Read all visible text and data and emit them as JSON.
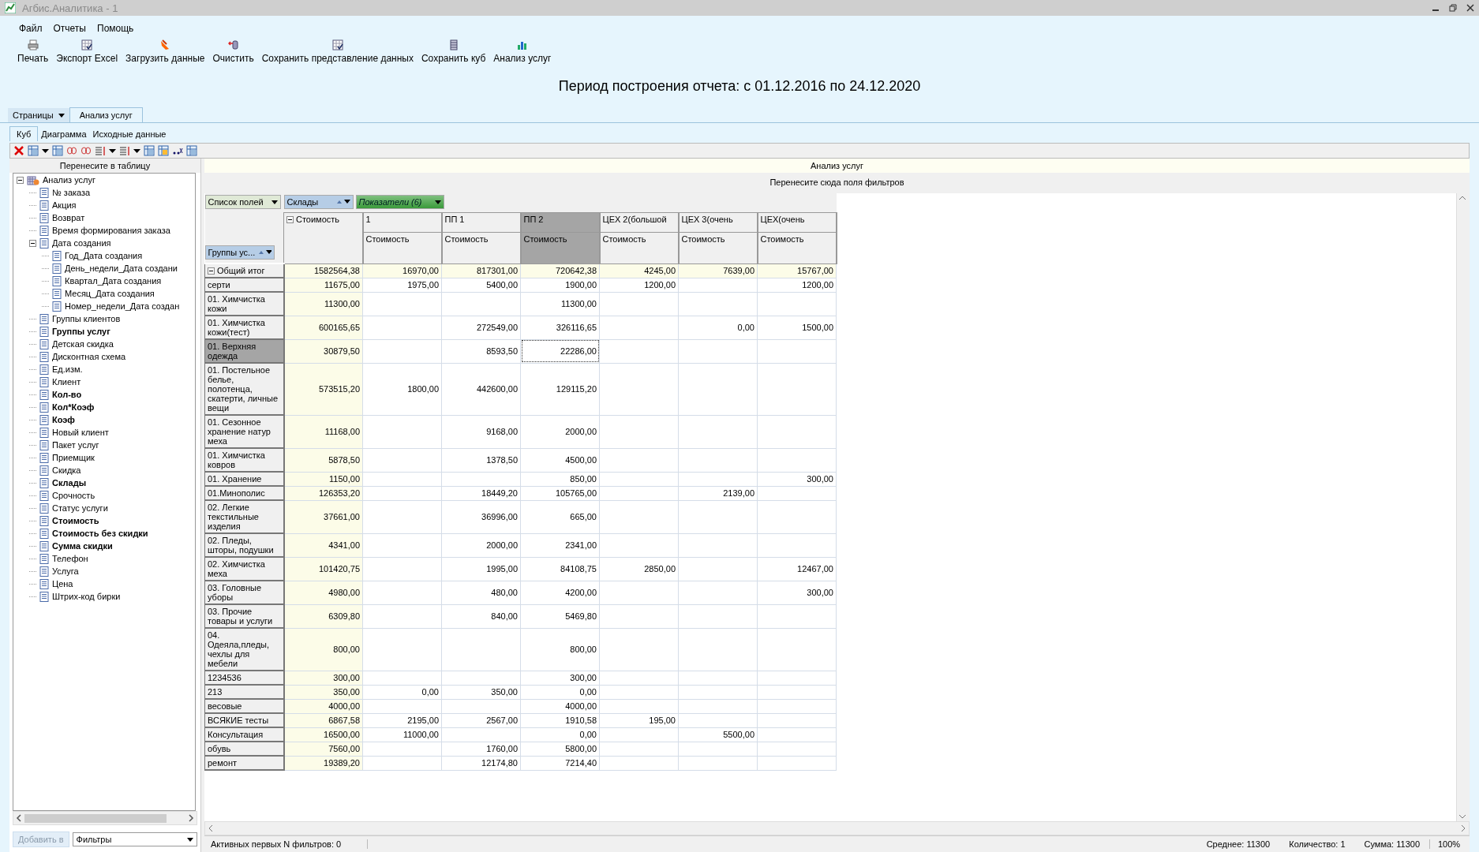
{
  "window": {
    "title": "Агбис.Аналитика - 1"
  },
  "menu": [
    "Файл",
    "Отчеты",
    "Помощь"
  ],
  "toolbar": [
    {
      "label": "Печать",
      "kind": "print"
    },
    {
      "label": "Экспорт Excel",
      "kind": "table"
    },
    {
      "label": "Загрузить данные",
      "kind": "load"
    },
    {
      "label": "Очистить",
      "kind": "clear"
    },
    {
      "label": "Сохранить представление данных",
      "kind": "table"
    },
    {
      "label": "Сохранить куб",
      "kind": "cube"
    },
    {
      "label": "Анализ услуг",
      "kind": "chart"
    }
  ],
  "report_period": "Период построения отчета: с 01.12.2016 по 24.12.2020",
  "pages_menu": "Страницы",
  "page_tabs": [
    {
      "label": "Анализ услуг",
      "selected": true
    }
  ],
  "sub_tabs": [
    {
      "label": "Куб",
      "selected": true
    },
    {
      "label": "Диаграмма",
      "selected": false
    },
    {
      "label": "Исходные данные",
      "selected": false
    }
  ],
  "field_list": {
    "header": "Перенесите в таблицу",
    "tree": {
      "label": "Анализ услуг",
      "expanded": true,
      "children": [
        {
          "label": "№ заказа",
          "used": false
        },
        {
          "label": "Акция",
          "used": false
        },
        {
          "label": "Возврат",
          "used": false
        },
        {
          "label": "Время формирования заказа",
          "used": false
        },
        {
          "label": "Дата создания",
          "used": false,
          "expanded": true,
          "children": [
            {
              "label": "Год_Дата создания",
              "used": false
            },
            {
              "label": "День_недели_Дата создани",
              "used": false
            },
            {
              "label": "Квартал_Дата создания",
              "used": false
            },
            {
              "label": "Месяц_Дата создания",
              "used": false
            },
            {
              "label": "Номер_недели_Дата создан",
              "used": false
            }
          ]
        },
        {
          "label": "Группы клиентов",
          "used": false
        },
        {
          "label": "Группы услуг",
          "used": true
        },
        {
          "label": "Детская скидка",
          "used": false
        },
        {
          "label": "Дисконтная схема",
          "used": false
        },
        {
          "label": "Ед.изм.",
          "used": false
        },
        {
          "label": "Клиент",
          "used": false
        },
        {
          "label": "Кол-во",
          "used": true
        },
        {
          "label": "Кол*Коэф",
          "used": true
        },
        {
          "label": "Коэф",
          "used": true
        },
        {
          "label": "Новый клиент",
          "used": false
        },
        {
          "label": "Пакет услуг",
          "used": false
        },
        {
          "label": "Приемщик",
          "used": false
        },
        {
          "label": "Скидка",
          "used": false
        },
        {
          "label": "Склады",
          "used": true
        },
        {
          "label": "Срочность",
          "used": false
        },
        {
          "label": "Статус услуги",
          "used": false
        },
        {
          "label": "Стоимость",
          "used": true
        },
        {
          "label": "Стоимость без скидки",
          "used": true
        },
        {
          "label": "Сумма скидки",
          "used": true
        },
        {
          "label": "Телефон",
          "used": false
        },
        {
          "label": "Услуга",
          "used": false
        },
        {
          "label": "Цена",
          "used": false
        },
        {
          "label": "Штрих-код бирки",
          "used": false
        }
      ]
    },
    "add_button": {
      "label": "Добавить в",
      "disabled": true
    },
    "add_target": "Фильтры"
  },
  "pivot": {
    "title": "Анализ услуг",
    "filter_hint": "Перенесите сюда поля фильтров",
    "field_buttons": [
      {
        "label": "Список полей",
        "kind": "list"
      },
      {
        "label": "Склады",
        "kind": "column"
      },
      {
        "label": "Показатели (6)",
        "kind": "data"
      }
    ],
    "row_field": "Группы ус...",
    "total_header": "Стоимость",
    "columns": [
      {
        "label": "1",
        "measure": "Стоимость",
        "selected": false
      },
      {
        "label": "ПП 1",
        "measure": "Стоимость",
        "selected": false
      },
      {
        "label": "ПП 2",
        "measure": "Стоимость",
        "selected": true
      },
      {
        "label": "ЦЕХ 2(большой",
        "measure": "Стоимость",
        "selected": false
      },
      {
        "label": "ЦЕХ 3(очень",
        "measure": "Стоимость",
        "selected": false
      },
      {
        "label": "ЦЕХ(очень",
        "measure": "Стоимость",
        "selected": false
      }
    ],
    "grand_total": {
      "label": "Общий итог",
      "total": "1582564,38",
      "cells": [
        {
          "kind": "value",
          "text": "16970,00"
        },
        {
          "kind": "value",
          "text": "817301,00"
        },
        {
          "kind": "value",
          "text": "720642,38"
        },
        {
          "kind": "value",
          "text": "4245,00"
        },
        {
          "kind": "value",
          "text": "7639,00"
        },
        {
          "kind": "value",
          "text": "15767,00"
        }
      ]
    },
    "rows": [
      {
        "label": "серти",
        "selected": false,
        "total": "11675,00",
        "cells": [
          {
            "kind": "value",
            "text": "1975,00"
          },
          {
            "kind": "value",
            "text": "5400,00"
          },
          {
            "kind": "value",
            "text": "1900,00"
          },
          {
            "kind": "value",
            "text": "1200,00"
          },
          {
            "kind": "empty"
          },
          {
            "kind": "value",
            "text": "1200,00"
          }
        ]
      },
      {
        "label": "01.  Химчистка кожи",
        "selected": false,
        "total": "11300,00",
        "cells": [
          {
            "kind": "empty"
          },
          {
            "kind": "empty"
          },
          {
            "kind": "value",
            "text": "11300,00"
          },
          {
            "kind": "empty"
          },
          {
            "kind": "empty"
          },
          {
            "kind": "empty"
          }
        ]
      },
      {
        "label": "01.  Химчистка кожи(тест)",
        "selected": false,
        "total": "600165,65",
        "cells": [
          {
            "kind": "empty"
          },
          {
            "kind": "value",
            "text": "272549,00"
          },
          {
            "kind": "value",
            "text": "326116,65"
          },
          {
            "kind": "empty"
          },
          {
            "kind": "value",
            "text": "0,00"
          },
          {
            "kind": "value",
            "text": "1500,00"
          }
        ]
      },
      {
        "label": "01. Верхняя одежда",
        "selected": true,
        "total": "30879,50",
        "cells": [
          {
            "kind": "empty"
          },
          {
            "kind": "value",
            "text": "8593,50"
          },
          {
            "kind": "value",
            "text": "22286,00"
          },
          {
            "kind": "empty"
          },
          {
            "kind": "empty"
          },
          {
            "kind": "empty"
          }
        ]
      },
      {
        "label": "01. Постельное белье, полотенца, скатерти, личные вещи",
        "selected": false,
        "total": "573515,20",
        "cells": [
          {
            "kind": "value",
            "text": "1800,00"
          },
          {
            "kind": "value",
            "text": "442600,00"
          },
          {
            "kind": "value",
            "text": "129115,20"
          },
          {
            "kind": "empty"
          },
          {
            "kind": "empty"
          },
          {
            "kind": "empty"
          }
        ]
      },
      {
        "label": "01. Сезонное хранение натур меха",
        "selected": false,
        "total": "11168,00",
        "cells": [
          {
            "kind": "empty"
          },
          {
            "kind": "value",
            "text": "9168,00"
          },
          {
            "kind": "value",
            "text": "2000,00"
          },
          {
            "kind": "empty"
          },
          {
            "kind": "empty"
          },
          {
            "kind": "empty"
          }
        ]
      },
      {
        "label": "01. Химчистка ковров",
        "selected": false,
        "total": "5878,50",
        "cells": [
          {
            "kind": "empty"
          },
          {
            "kind": "value",
            "text": "1378,50"
          },
          {
            "kind": "value",
            "text": "4500,00"
          },
          {
            "kind": "empty"
          },
          {
            "kind": "empty"
          },
          {
            "kind": "empty"
          }
        ]
      },
      {
        "label": "01. Хранение",
        "selected": false,
        "total": "1150,00",
        "cells": [
          {
            "kind": "empty"
          },
          {
            "kind": "empty"
          },
          {
            "kind": "value",
            "text": "850,00"
          },
          {
            "kind": "empty"
          },
          {
            "kind": "empty"
          },
          {
            "kind": "value",
            "text": "300,00"
          }
        ]
      },
      {
        "label": "01.Минополис",
        "selected": false,
        "total": "126353,20",
        "cells": [
          {
            "kind": "empty"
          },
          {
            "kind": "value",
            "text": "18449,20"
          },
          {
            "kind": "value",
            "text": "105765,00"
          },
          {
            "kind": "empty"
          },
          {
            "kind": "value",
            "text": "2139,00"
          },
          {
            "kind": "empty"
          }
        ]
      },
      {
        "label": "02. Легкие текстильные изделия",
        "selected": false,
        "total": "37661,00",
        "cells": [
          {
            "kind": "empty"
          },
          {
            "kind": "value",
            "text": "36996,00"
          },
          {
            "kind": "value",
            "text": "665,00"
          },
          {
            "kind": "empty"
          },
          {
            "kind": "empty"
          },
          {
            "kind": "empty"
          }
        ]
      },
      {
        "label": "02. Пледы, шторы, подушки",
        "selected": false,
        "total": "4341,00",
        "cells": [
          {
            "kind": "empty"
          },
          {
            "kind": "value",
            "text": "2000,00"
          },
          {
            "kind": "value",
            "text": "2341,00"
          },
          {
            "kind": "empty"
          },
          {
            "kind": "empty"
          },
          {
            "kind": "empty"
          }
        ]
      },
      {
        "label": "02. Химчистка меха",
        "selected": false,
        "total": "101420,75",
        "cells": [
          {
            "kind": "empty"
          },
          {
            "kind": "value",
            "text": "1995,00"
          },
          {
            "kind": "value",
            "text": "84108,75"
          },
          {
            "kind": "value",
            "text": "2850,00"
          },
          {
            "kind": "empty"
          },
          {
            "kind": "value",
            "text": "12467,00"
          }
        ]
      },
      {
        "label": "03. Головные уборы",
        "selected": false,
        "total": "4980,00",
        "cells": [
          {
            "kind": "empty"
          },
          {
            "kind": "value",
            "text": "480,00"
          },
          {
            "kind": "value",
            "text": "4200,00"
          },
          {
            "kind": "empty"
          },
          {
            "kind": "empty"
          },
          {
            "kind": "value",
            "text": "300,00"
          }
        ]
      },
      {
        "label": "03. Прочие товары и услуги",
        "selected": false,
        "total": "6309,80",
        "cells": [
          {
            "kind": "empty"
          },
          {
            "kind": "value",
            "text": "840,00"
          },
          {
            "kind": "value",
            "text": "5469,80"
          },
          {
            "kind": "empty"
          },
          {
            "kind": "empty"
          },
          {
            "kind": "empty"
          }
        ]
      },
      {
        "label": "04. Одеяла,пледы, чехлы для мебели",
        "selected": false,
        "total": "800,00",
        "cells": [
          {
            "kind": "empty"
          },
          {
            "kind": "empty"
          },
          {
            "kind": "value",
            "text": "800,00"
          },
          {
            "kind": "empty"
          },
          {
            "kind": "empty"
          },
          {
            "kind": "empty"
          }
        ]
      },
      {
        "label": "1234536",
        "selected": false,
        "total": "300,00",
        "cells": [
          {
            "kind": "empty"
          },
          {
            "kind": "empty"
          },
          {
            "kind": "value",
            "text": "300,00"
          },
          {
            "kind": "empty"
          },
          {
            "kind": "empty"
          },
          {
            "kind": "empty"
          }
        ]
      },
      {
        "label": "213",
        "selected": false,
        "total": "350,00",
        "cells": [
          {
            "kind": "value",
            "text": "0,00"
          },
          {
            "kind": "value",
            "text": "350,00"
          },
          {
            "kind": "value",
            "text": "0,00"
          },
          {
            "kind": "empty"
          },
          {
            "kind": "empty"
          },
          {
            "kind": "empty"
          }
        ]
      },
      {
        "label": "весовые",
        "selected": false,
        "total": "4000,00",
        "cells": [
          {
            "kind": "empty"
          },
          {
            "kind": "empty"
          },
          {
            "kind": "value",
            "text": "4000,00"
          },
          {
            "kind": "empty"
          },
          {
            "kind": "empty"
          },
          {
            "kind": "empty"
          }
        ]
      },
      {
        "label": "ВСЯКИЕ тесты",
        "selected": false,
        "total": "6867,58",
        "cells": [
          {
            "kind": "value",
            "text": "2195,00"
          },
          {
            "kind": "value",
            "text": "2567,00"
          },
          {
            "kind": "value",
            "text": "1910,58"
          },
          {
            "kind": "value",
            "text": "195,00"
          },
          {
            "kind": "empty"
          },
          {
            "kind": "empty"
          }
        ]
      },
      {
        "label": "Консультация",
        "selected": false,
        "total": "16500,00",
        "cells": [
          {
            "kind": "value",
            "text": "11000,00"
          },
          {
            "kind": "empty"
          },
          {
            "kind": "value",
            "text": "0,00"
          },
          {
            "kind": "empty"
          },
          {
            "kind": "value",
            "text": "5500,00"
          },
          {
            "kind": "empty"
          }
        ]
      },
      {
        "label": "обувь",
        "selected": false,
        "total": "7560,00",
        "cells": [
          {
            "kind": "empty"
          },
          {
            "kind": "value",
            "text": "1760,00"
          },
          {
            "kind": "value",
            "text": "5800,00"
          },
          {
            "kind": "empty"
          },
          {
            "kind": "empty"
          },
          {
            "kind": "empty"
          }
        ]
      },
      {
        "label": "ремонт",
        "selected": false,
        "total": "19389,20",
        "cells": [
          {
            "kind": "empty"
          },
          {
            "kind": "value",
            "text": "12174,80"
          },
          {
            "kind": "value",
            "text": "7214,40"
          },
          {
            "kind": "empty"
          },
          {
            "kind": "empty"
          },
          {
            "kind": "empty"
          }
        ]
      }
    ]
  },
  "status_bar": {
    "text": "Активных первых N фильтров: 0",
    "average": "Среднее: 11300",
    "count": "Количество: 1",
    "sum": "Сумма: 11300",
    "zoom": "100%"
  }
}
